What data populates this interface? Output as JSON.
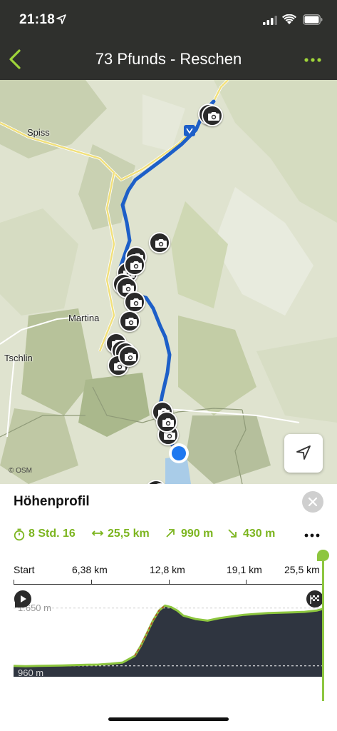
{
  "status_bar": {
    "time": "21:18"
  },
  "nav": {
    "title": "73 Pfunds - Reschen"
  },
  "map": {
    "places": [
      "Spiss",
      "Martina",
      "Tschlin"
    ],
    "attribution": "© OSM",
    "photo_count": 20
  },
  "panel": {
    "title": "Höhenprofil",
    "stats": {
      "duration": "8 Std. 16",
      "distance": "25,5 km",
      "ascent": "990 m",
      "descent": "430 m"
    },
    "axis_labels": [
      "Start",
      "6,38 km",
      "12,8 km",
      "19,1 km",
      "25,5 km"
    ],
    "elevation_labels": {
      "high": "1.650 m",
      "low": "960 m"
    }
  },
  "chart_data": {
    "type": "area",
    "title": "Höhenprofil",
    "xlabel": "",
    "ylabel": "",
    "x_tick_labels": [
      "Start",
      "6,38 km",
      "12,8 km",
      "19,1 km",
      "25,5 km"
    ],
    "xlim": [
      0,
      25.5
    ],
    "y_reference_lines": [
      1650,
      960
    ],
    "series": [
      {
        "x": [
          0,
          1,
          2,
          3,
          4,
          5,
          6,
          7,
          8,
          9,
          10,
          10.5,
          11,
          11.5,
          12,
          12.5,
          13,
          13.5,
          14,
          15,
          16,
          17,
          18,
          19,
          20,
          21,
          22,
          23,
          24,
          25,
          25.5
        ],
        "y": [
          960,
          955,
          960,
          962,
          965,
          968,
          972,
          975,
          985,
          1000,
          1080,
          1200,
          1350,
          1500,
          1620,
          1680,
          1660,
          1620,
          1560,
          1520,
          1500,
          1530,
          1550,
          1570,
          1580,
          1590,
          1595,
          1600,
          1605,
          1620,
          1640
        ]
      }
    ],
    "colors": {
      "area": "#2f3540",
      "line": "#8dc63f"
    }
  }
}
